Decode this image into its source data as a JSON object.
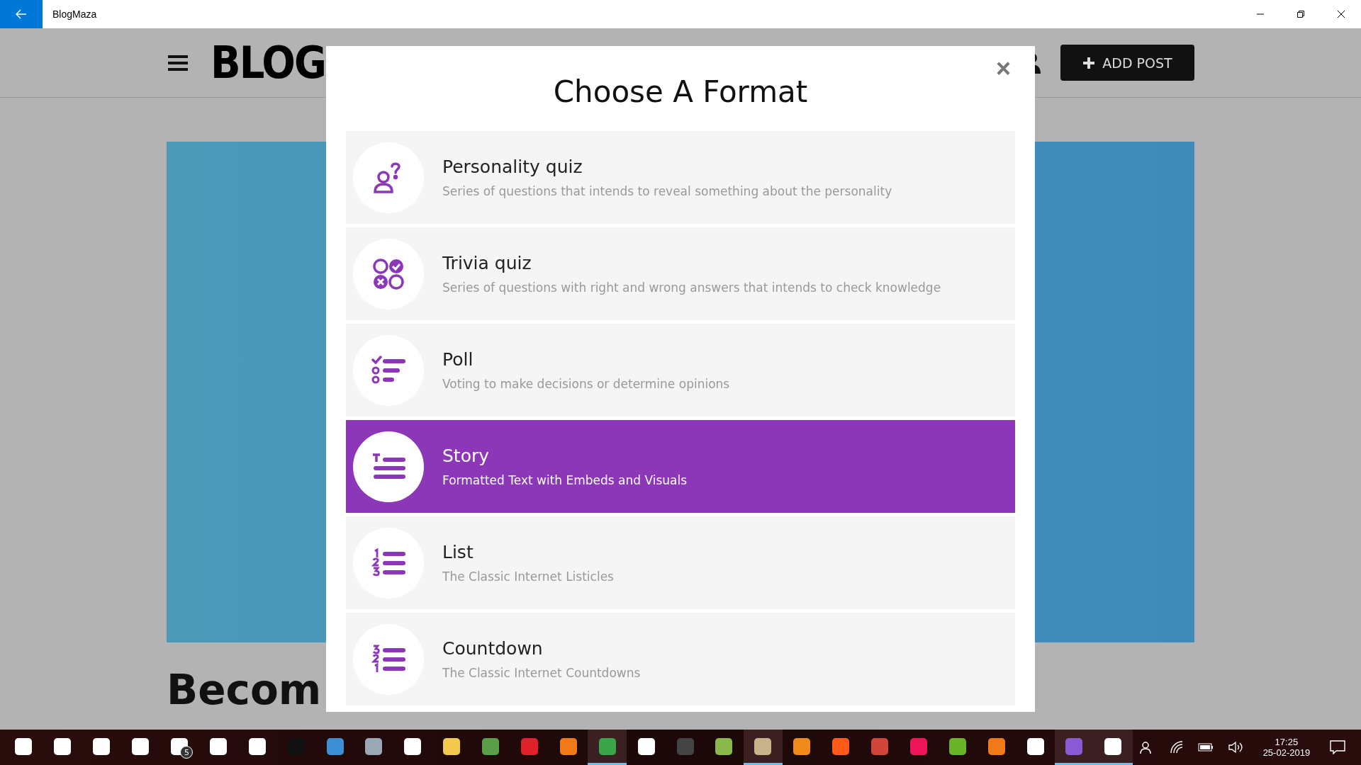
{
  "window": {
    "title": "BlogMaza"
  },
  "header": {
    "logo": "BLOG",
    "add_button": "ADD POST"
  },
  "page": {
    "heading": "Becom"
  },
  "modal": {
    "title": "Choose A Format",
    "close": "×",
    "formats": [
      {
        "kind": "personality",
        "title": "Personality quiz",
        "description": "Series of questions that intends to reveal something about the personality",
        "selected": false
      },
      {
        "kind": "trivia",
        "title": "Trivia quiz",
        "description": "Series of questions with right and wrong answers that intends to check knowledge",
        "selected": false
      },
      {
        "kind": "poll",
        "title": "Poll",
        "description": "Voting to make decisions or determine opinions",
        "selected": false
      },
      {
        "kind": "story",
        "title": "Story",
        "description": "Formatted Text with Embeds and Visuals",
        "selected": true
      },
      {
        "kind": "list",
        "title": "List",
        "description": "The Classic Internet Listicles",
        "selected": false
      },
      {
        "kind": "countdown",
        "title": "Countdown",
        "description": "The Classic Internet Countdowns",
        "selected": false
      }
    ]
  },
  "taskbar": {
    "apps": [
      {
        "color": "#ffffff",
        "active": false
      },
      {
        "color": "#ffffff",
        "active": false
      },
      {
        "color": "#ffffff",
        "active": false
      },
      {
        "color": "#ffffff",
        "active": false
      },
      {
        "color": "#ffffff",
        "active": false,
        "badge": "5"
      },
      {
        "color": "#ffffff",
        "active": false
      },
      {
        "color": "#ffffff",
        "active": false
      },
      {
        "color": "#111111",
        "active": false
      },
      {
        "color": "#3b8fd6",
        "active": false
      },
      {
        "color": "#9aa7b5",
        "active": false
      },
      {
        "color": "#ffffff",
        "active": false
      },
      {
        "color": "#f2c94c",
        "active": false
      },
      {
        "color": "#5a9e4a",
        "active": false
      },
      {
        "color": "#e0202a",
        "active": false
      },
      {
        "color": "#f07a1a",
        "active": false
      },
      {
        "color": "#3aa54a",
        "active": true
      },
      {
        "color": "#ffffff",
        "active": false
      },
      {
        "color": "#444444",
        "active": false
      },
      {
        "color": "#8ab84a",
        "active": false
      },
      {
        "color": "#c8b48a",
        "active": true
      },
      {
        "color": "#f08a1a",
        "active": false
      },
      {
        "color": "#ff5a1a",
        "active": false
      },
      {
        "color": "#d2453a",
        "active": false
      },
      {
        "color": "#f0145a",
        "active": false
      },
      {
        "color": "#6ab42a",
        "active": false
      },
      {
        "color": "#f07a1a",
        "active": false
      },
      {
        "color": "#ffffff",
        "active": false
      },
      {
        "color": "#8a5ad6",
        "active": true
      },
      {
        "color": "#ffffff",
        "active": true
      }
    ],
    "time": "17:25",
    "date": "25-02-2019"
  }
}
